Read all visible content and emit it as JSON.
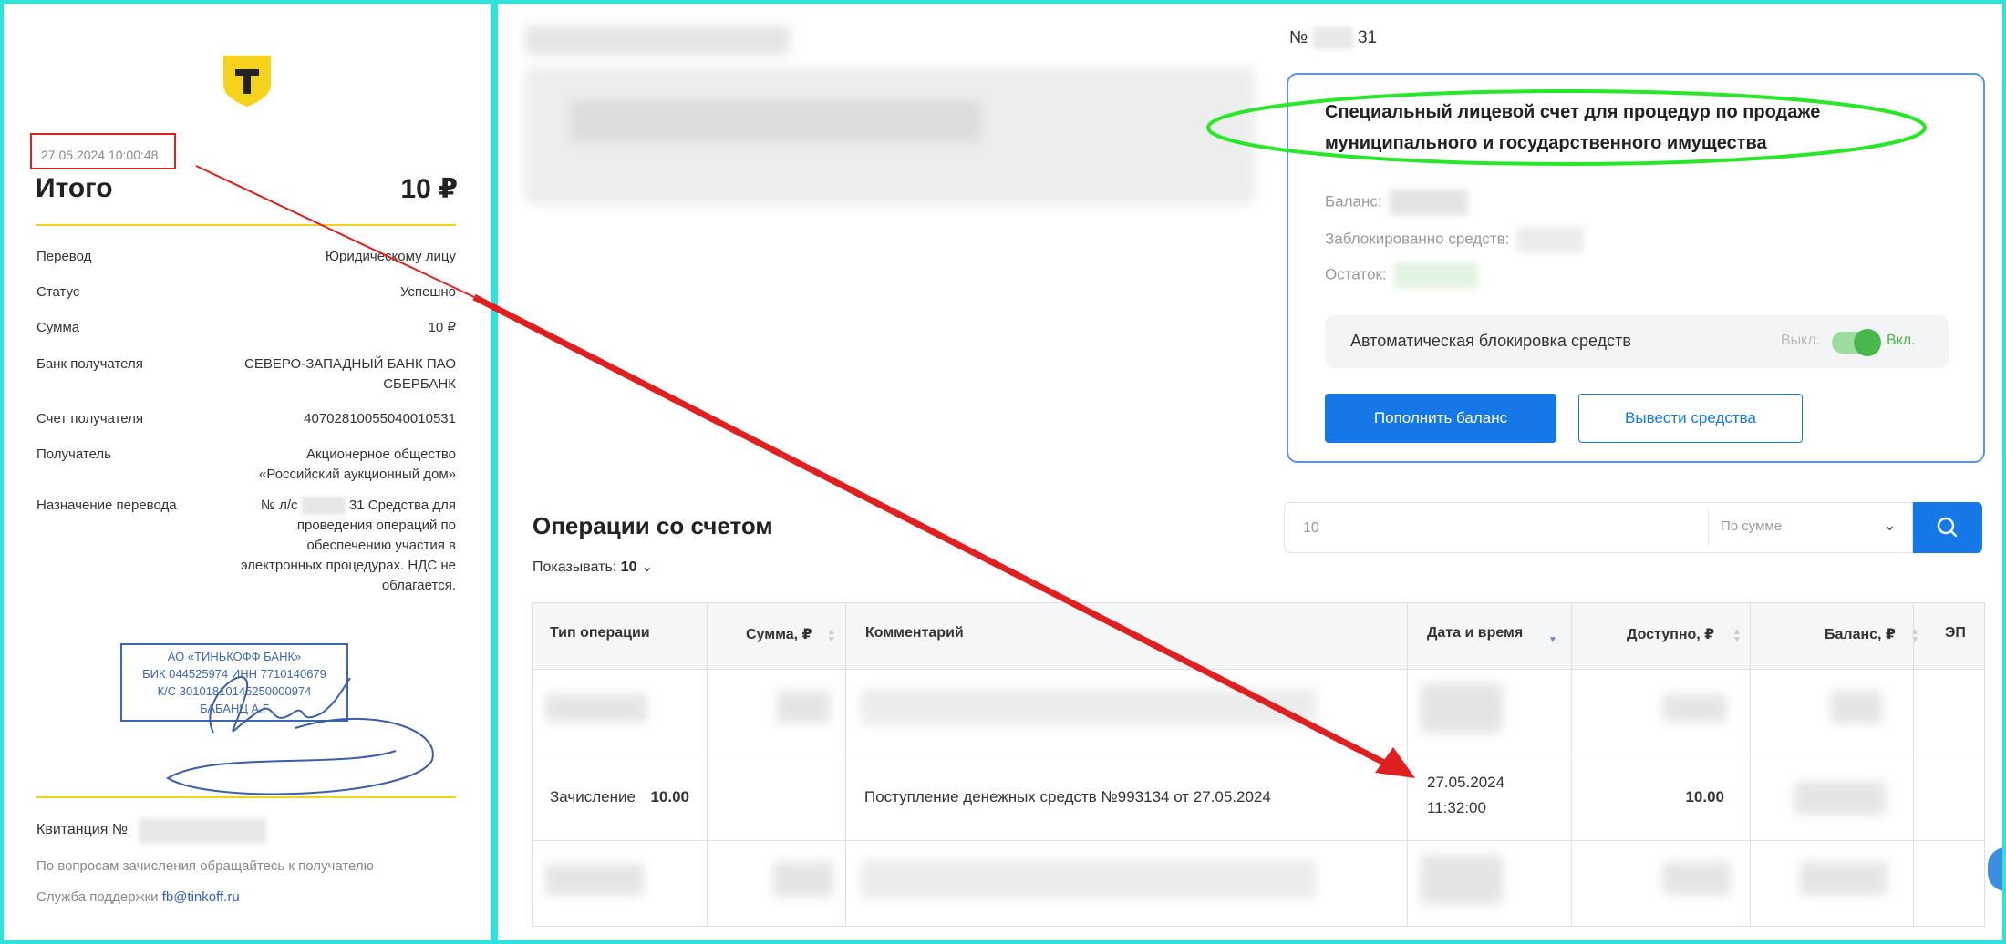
{
  "receipt": {
    "datetime": "27.05.2024 10:00:48",
    "total_label": "Итого",
    "total_value": "10 ₽",
    "rows": [
      {
        "key": "Перевод",
        "value": "Юридическому лицу"
      },
      {
        "key": "Статус",
        "value": "Успешно"
      },
      {
        "key": "Сумма",
        "value": "10 ₽"
      },
      {
        "key": "Банк получателя",
        "value_lines": [
          "СЕВЕРО-ЗАПАДНЫЙ БАНК ПАО",
          "СБЕРБАНК"
        ]
      },
      {
        "key": "Счет получателя",
        "value": "40702810055040010531"
      },
      {
        "key": "Получатель",
        "value_lines": [
          "Акционерное общество",
          "«Российский аукционный дом»"
        ]
      },
      {
        "key": "Назначение перевода",
        "value_prefix": "№ л/с",
        "value_first_suffix": "31 Средства для",
        "value_lines": [
          "проведения операций по",
          "обеспечению участия в",
          "электронных процедурах.  НДС не",
          "облагается."
        ]
      }
    ],
    "stamp_lines": [
      "АО «ТИНЬКОФФ БАНК»",
      "БИК 044525974 ИНН 7710140679",
      "К/С 30101810145250000974",
      "БАБАНЦ А.Г"
    ],
    "receipt_label": "Квитанция  №",
    "note": "По вопросам зачисления обращайтесь к получателю",
    "support_label": "Служба поддержки",
    "support_email": "fb@tinkoff.ru",
    "colors": {
      "accent": "#f5d21c",
      "highlight": "#e02020",
      "stamp": "#3d66b5"
    }
  },
  "account": {
    "number_prefix": "№",
    "number_suffix": "31",
    "title": "Специальный лицевой счет для процедур по продаже муниципального и государственного имущества",
    "balance_label": "Баланс:",
    "blocked_label": "Заблокированно средств:",
    "remainder_label": "Остаток:",
    "auto_block_label": "Автоматическая блокировка средств",
    "toggle_off_label": "Выкл.",
    "toggle_on_label": "Вкл.",
    "toggle_state": "on",
    "topup_button": "Пополнить баланс",
    "withdraw_button": "Вывести средства",
    "colors": {
      "primary": "#1578e8",
      "border": "#5b93e6",
      "toggle": "#48b84c",
      "ellipse": "#28e628"
    }
  },
  "operations": {
    "title": "Операции со счетом",
    "show_label": "Показывать:",
    "show_value": "10",
    "search_value": "10",
    "sort_option": "По сумме",
    "headers": [
      "Тип операции",
      "Сумма, ₽",
      "Комментарий",
      "Дата и время",
      "Доступно, ₽",
      "Баланс, ₽",
      "ЭП"
    ],
    "visible_row": {
      "type": "Зачисление",
      "amount": "10.00",
      "comment": "Поступление денежных средств №993134 от 27.05.2024",
      "date": "27.05.2024",
      "time": "11:32:00",
      "available": "10.00"
    }
  }
}
